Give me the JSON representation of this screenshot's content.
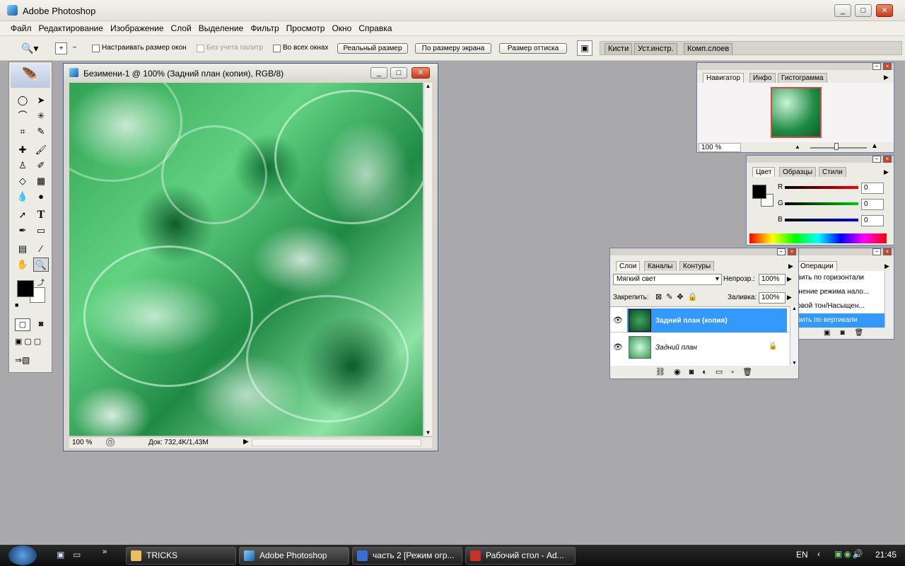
{
  "app": {
    "title": "Adobe Photoshop"
  },
  "menu": [
    "Файл",
    "Редактирование",
    "Изображение",
    "Слой",
    "Выделение",
    "Фильтр",
    "Просмотр",
    "Окно",
    "Справка"
  ],
  "options": {
    "resize_windows": "Настраивать размер окон",
    "ignore_palettes": "Без учета палитр",
    "all_windows": "Во всех окнах",
    "actual_pixels": "Реальный размер",
    "fit_screen": "По размеру экрана",
    "print_size": "Размер оттиска"
  },
  "palette_well": [
    "Кисти",
    "Уст.инстр.",
    "Комп.слоев"
  ],
  "document": {
    "title": "Безимени-1 @ 100% (Задний план (копия), RGB/8)",
    "zoom": "100 %",
    "doc_info": "Док: 732,4K/1,43M"
  },
  "navigator": {
    "tabs": [
      "Навигатор",
      "Инфо",
      "Гистограмма"
    ],
    "zoom": "100 %"
  },
  "color": {
    "tabs": [
      "Цвет",
      "Образцы",
      "Стили"
    ],
    "r_label": "R",
    "g_label": "G",
    "b_label": "B",
    "r": "0",
    "g": "0",
    "b": "0",
    "fg": "#000000",
    "bg": "#ffffff"
  },
  "actions": {
    "tab": "Операции",
    "items": [
      "Отразить по горизонтали",
      "Изменение режима нало...",
      "Цветовой тон/Насыщен...",
      "Отразить по вертикали"
    ]
  },
  "layers": {
    "tabs": [
      "Слои",
      "Каналы",
      "Контуры"
    ],
    "blend_mode": "Мягкий свет",
    "opacity_label": "Непрозр.:",
    "opacity": "100%",
    "lock_label": "Закрепить:",
    "fill_label": "Заливка:",
    "fill": "100%",
    "items": [
      "Задний план (копия)",
      "Задний план"
    ]
  },
  "taskbar": {
    "items": [
      "TRICKS",
      "Adobe Photoshop",
      "часть 2 [Режим огр...",
      "Рабочий стол - Ad..."
    ],
    "lang": "EN",
    "time": "21:45"
  },
  "colors": {
    "selection": "#3399ff",
    "title_accent": "#3f5f9a"
  }
}
